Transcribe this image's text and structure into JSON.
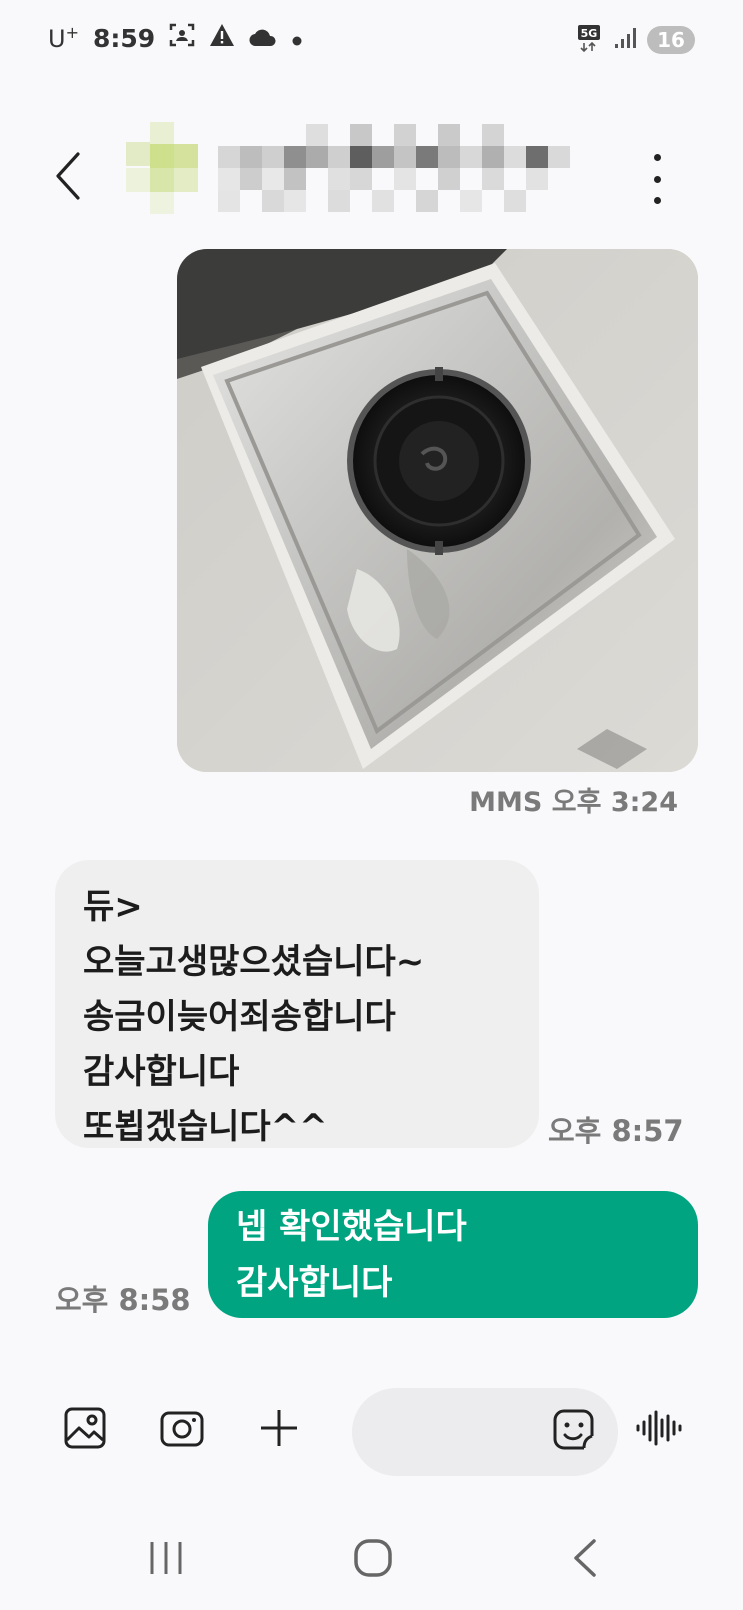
{
  "status_bar": {
    "carrier": "U",
    "carrier_sup": "+",
    "time": "8:59",
    "network": "5G",
    "battery": "16",
    "icons": [
      "screenshot-icon",
      "warning-icon",
      "cloud-icon",
      "dot-icon",
      "network-5g-icon",
      "signal-icon"
    ]
  },
  "header": {
    "back_icon": "chevron-left-icon",
    "more_icon": "more-vertical-icon"
  },
  "messages": {
    "mms": {
      "meta": "MMS 오후 3:24"
    },
    "received": {
      "lines": [
        "듀>",
        "오늘고생많으셨습니다~",
        "송금이늦어죄송합니다",
        "감사합니다",
        "또뵙겠습니다^^"
      ],
      "time": "오후 8:57"
    },
    "sent": {
      "lines": [
        "넵 확인했습니다",
        "감사합니다"
      ],
      "time": "오후 8:58"
    }
  },
  "composer": {
    "icons": [
      "gallery-icon",
      "camera-icon",
      "plus-icon",
      "emoji-icon",
      "voice-icon"
    ],
    "input_value": ""
  },
  "navbar": {
    "icons": [
      "recents-icon",
      "home-icon",
      "back-icon"
    ]
  },
  "colors": {
    "sent_bubble": "#00a481",
    "received_bubble": "#efefef",
    "background": "#f9f9fb"
  }
}
